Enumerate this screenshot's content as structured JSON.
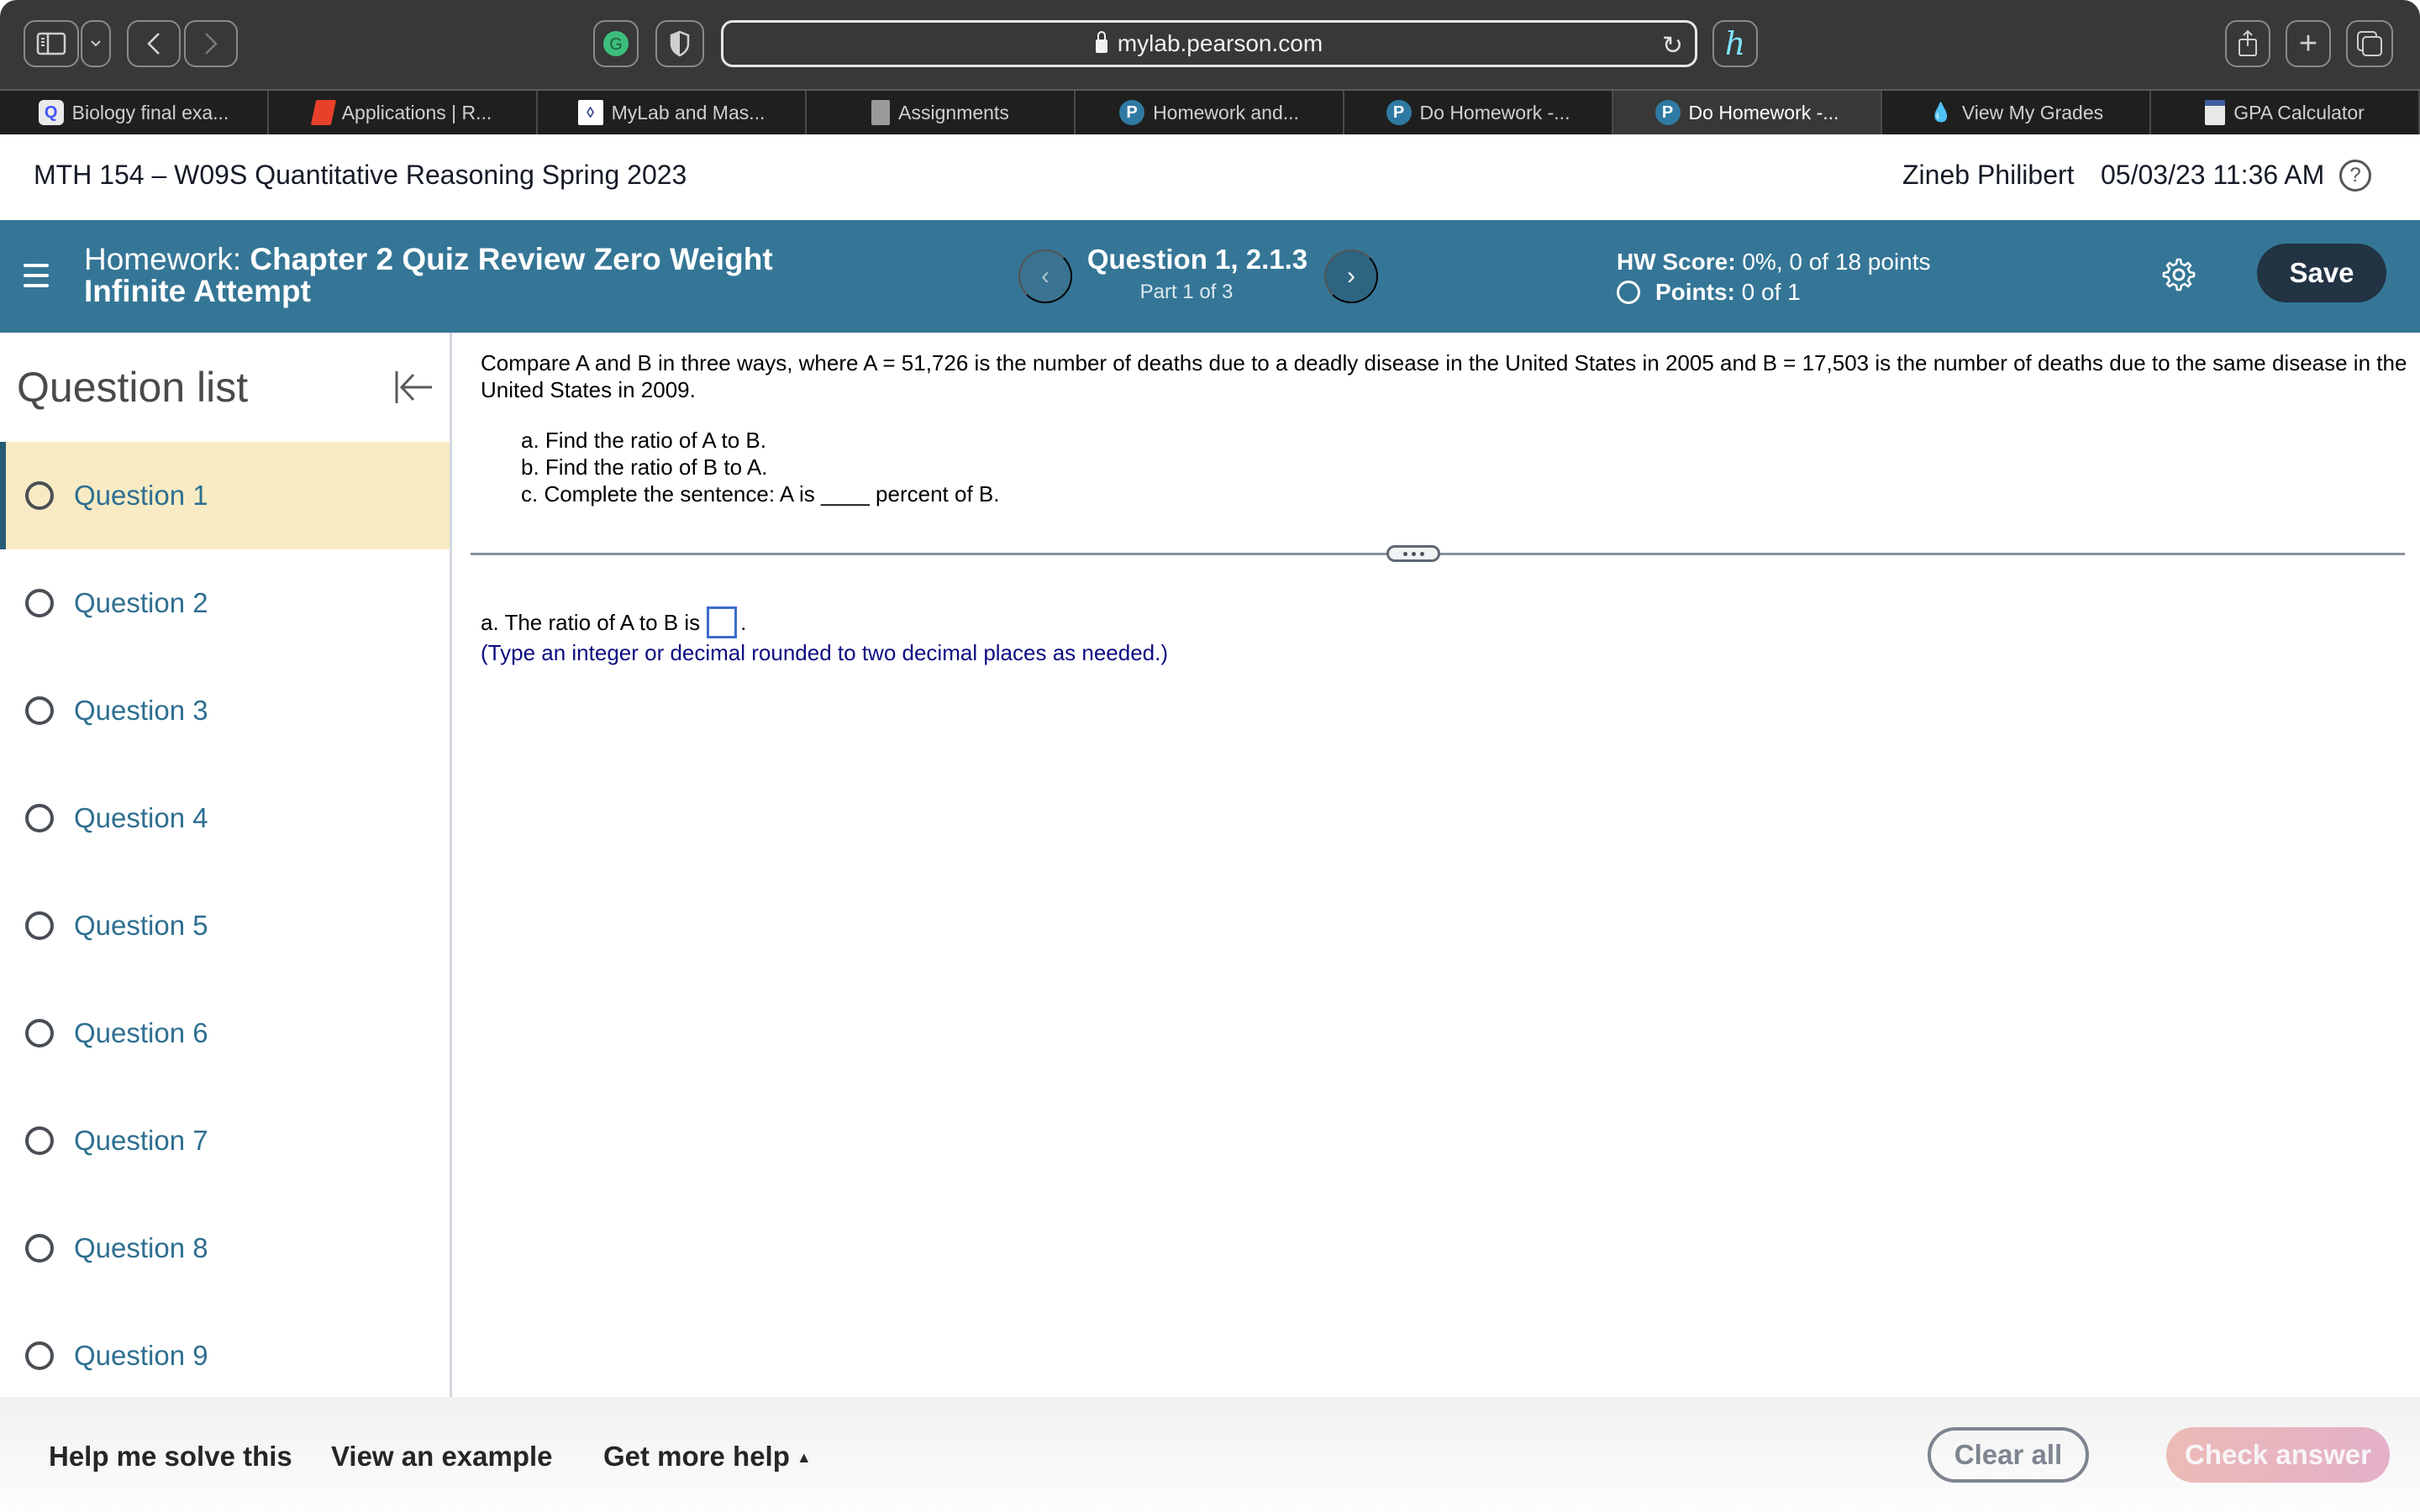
{
  "browser": {
    "url": "mylab.pearson.com",
    "toolbar_icons": [
      "sidebar-icon",
      "chevron-down-icon",
      "back-icon",
      "forward-icon",
      "grammarly-icon",
      "shield-icon",
      "honey-icon",
      "share-icon",
      "new-tab-icon",
      "tab-overview-icon"
    ],
    "tabs": [
      {
        "label": "Biology final exa...",
        "icon": "quizlet-icon",
        "active": false
      },
      {
        "label": "Applications | R...",
        "icon": "rutgers-icon",
        "active": false
      },
      {
        "label": "MyLab and Mas...",
        "icon": "mylab-icon",
        "active": false
      },
      {
        "label": "Assignments",
        "icon": "document-icon",
        "active": false
      },
      {
        "label": "Homework and...",
        "icon": "pearson-icon",
        "active": false
      },
      {
        "label": "Do Homework -...",
        "icon": "pearson-icon",
        "active": false
      },
      {
        "label": "Do Homework -...",
        "icon": "pearson-icon",
        "active": true
      },
      {
        "label": "View My Grades",
        "icon": "flame-icon",
        "active": false
      },
      {
        "label": "GPA Calculator",
        "icon": "calculator-icon",
        "active": false
      }
    ]
  },
  "course": {
    "title": "MTH 154 – W09S Quantitative Reasoning Spring 2023",
    "user": "Zineb Philibert",
    "datetime": "05/03/23 11:36 AM",
    "help": "?"
  },
  "homework": {
    "label": "Homework:",
    "name": "Chapter 2 Quiz Review Zero Weight Infinite Attempt",
    "question_title": "Question 1, 2.1.3",
    "question_part": "Part 1 of 3",
    "prev": "‹",
    "next": "›",
    "score_label": "HW Score:",
    "score_value": "0%, 0 of 18 points",
    "points_label": "Points:",
    "points_value": "0 of 1",
    "save_label": "Save"
  },
  "sidebar": {
    "title": "Question list",
    "items": [
      {
        "label": "Question 1",
        "active": true
      },
      {
        "label": "Question 2",
        "active": false
      },
      {
        "label": "Question 3",
        "active": false
      },
      {
        "label": "Question 4",
        "active": false
      },
      {
        "label": "Question 5",
        "active": false
      },
      {
        "label": "Question 6",
        "active": false
      },
      {
        "label": "Question 7",
        "active": false
      },
      {
        "label": "Question 8",
        "active": false
      },
      {
        "label": "Question 9",
        "active": false
      }
    ]
  },
  "question": {
    "prompt": "Compare A and B in three ways, where A = 51,726 is the number of deaths due to a deadly  disease in the United States in 2005 and B = 17,503 is the number of deaths due to the same disease in the United States in 2009.",
    "parts": [
      "a. Find the ratio of A to B.",
      "b. Find the ratio of B to A.",
      "c. Complete the sentence: A is ____ percent of B."
    ],
    "answer_prefix": "a. The ratio of A to B is",
    "answer_value": "",
    "answer_suffix": ".",
    "hint": "(Type an integer or decimal rounded to two decimal places as needed.)"
  },
  "footer": {
    "help_solve": "Help me solve this",
    "view_example": "View an example",
    "more_help": "Get more help",
    "more_help_caret": "▲",
    "clear_all": "Clear all",
    "check_answer": "Check answer"
  },
  "colors": {
    "header_blue": "#357696",
    "save_dark": "#223344",
    "active_question_bg": "#f8ebc3",
    "question_link": "#2e6f91",
    "hint_navy": "#0b0b80",
    "check_answer_pink": "#e8b4bf"
  }
}
